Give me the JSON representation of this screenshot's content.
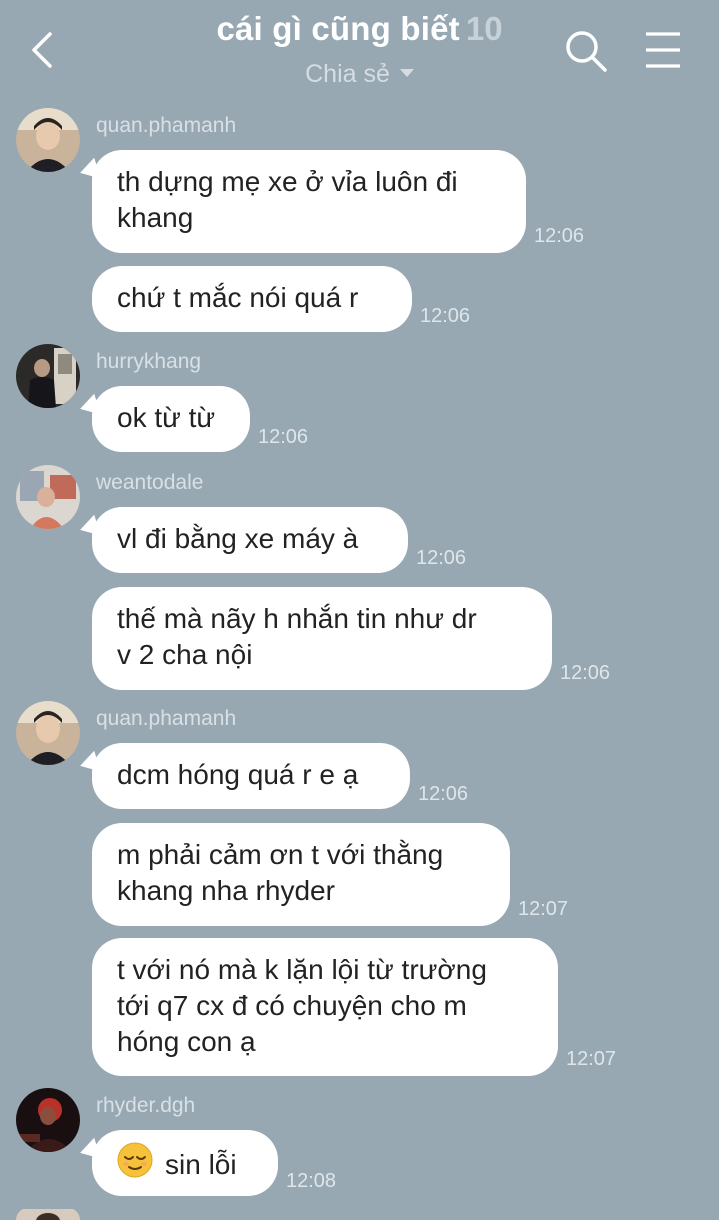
{
  "header": {
    "title": "cái gì cũng biết",
    "member_count": "10",
    "subtitle": "Chia sẻ",
    "icons": {
      "back": "chevron-left-icon",
      "search": "search-icon",
      "menu": "menu-icon"
    }
  },
  "messages": [
    {
      "sender": "quan.phamanh",
      "lines": [
        "th dựng mẹ xe ở vỉa luôn đi",
        "khang"
      ],
      "time": "12:06"
    },
    {
      "lines": [
        "chứ t mắc nói quá r"
      ],
      "time": "12:06"
    },
    {
      "sender": "hurrykhang",
      "lines": [
        "ok từ từ"
      ],
      "time": "12:06"
    },
    {
      "sender": "weantodale",
      "lines": [
        "vl đi bằng xe máy à"
      ],
      "time": "12:06"
    },
    {
      "lines": [
        "thế mà nãy h nhắn tin như dr",
        "v 2 cha nội"
      ],
      "time": "12:06"
    },
    {
      "sender": "quan.phamanh",
      "lines": [
        "dcm hóng quá r e ạ"
      ],
      "time": "12:06"
    },
    {
      "lines": [
        "m phải cảm ơn t với thằng",
        "khang nha rhyder"
      ],
      "time": "12:07"
    },
    {
      "lines": [
        "t với nó mà k lặn lội từ trường",
        "tới q7 cx đ có chuyện cho m",
        "hóng con ạ"
      ],
      "time": "12:07"
    },
    {
      "sender": "rhyder.dgh",
      "lines": [
        "sin lỗi"
      ],
      "time": "12:08",
      "emoji": "relieved-face-emoji"
    }
  ],
  "colors": {
    "background": "#97a8b3",
    "bubble": "#ffffff",
    "title": "#ffffff"
  }
}
